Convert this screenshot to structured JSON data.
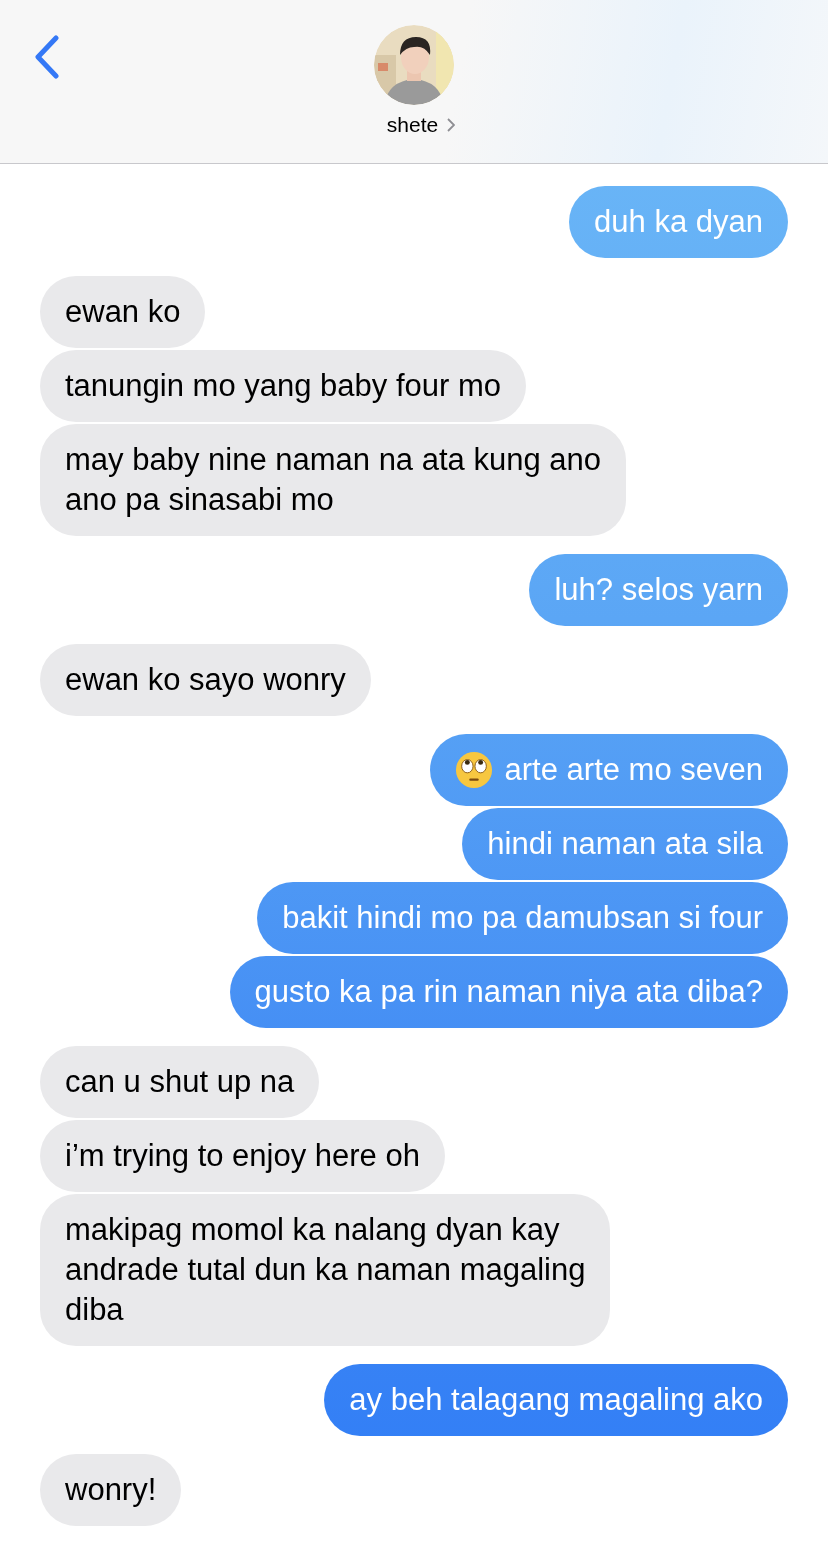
{
  "header": {
    "contact_name": "shete"
  },
  "groups": [
    {
      "kind": "sent",
      "messages": [
        {
          "kind": "text",
          "lines": [
            "duh ka dyan"
          ]
        }
      ]
    },
    {
      "kind": "received",
      "messages": [
        {
          "kind": "text",
          "lines": [
            "ewan ko"
          ]
        },
        {
          "kind": "text",
          "lines": [
            "tanungin mo yang baby four mo"
          ]
        },
        {
          "kind": "text",
          "lines": [
            "may baby nine naman na ata kung ano",
            "ano pa sinasabi mo"
          ]
        }
      ]
    },
    {
      "kind": "sent",
      "messages": [
        {
          "kind": "text",
          "lines": [
            "luh? selos yarn"
          ]
        }
      ]
    },
    {
      "kind": "received",
      "messages": [
        {
          "kind": "text",
          "lines": [
            "ewan ko sayo wonry"
          ]
        }
      ]
    },
    {
      "kind": "sent",
      "messages": [
        {
          "kind": "emoji",
          "lines": [
            "arte arte mo seven"
          ]
        },
        {
          "kind": "text",
          "lines": [
            "hindi naman ata sila"
          ]
        },
        {
          "kind": "text",
          "lines": [
            "bakit hindi mo pa damubsan si four"
          ]
        },
        {
          "kind": "text",
          "lines": [
            "gusto ka pa rin naman niya ata diba?"
          ]
        }
      ]
    },
    {
      "kind": "received",
      "messages": [
        {
          "kind": "text",
          "lines": [
            "can u shut up na"
          ]
        },
        {
          "kind": "text",
          "lines": [
            "i’m trying to enjoy here oh"
          ]
        },
        {
          "kind": "text",
          "lines": [
            "makipag momol ka nalang dyan kay",
            "andrade tutal dun ka naman magaling",
            "diba"
          ]
        }
      ]
    },
    {
      "kind": "sent",
      "messages": [
        {
          "kind": "text",
          "lines": [
            "ay beh talagang magaling ako"
          ]
        }
      ]
    },
    {
      "kind": "received",
      "messages": [
        {
          "kind": "text",
          "lines": [
            "wonry!"
          ]
        }
      ]
    }
  ]
}
